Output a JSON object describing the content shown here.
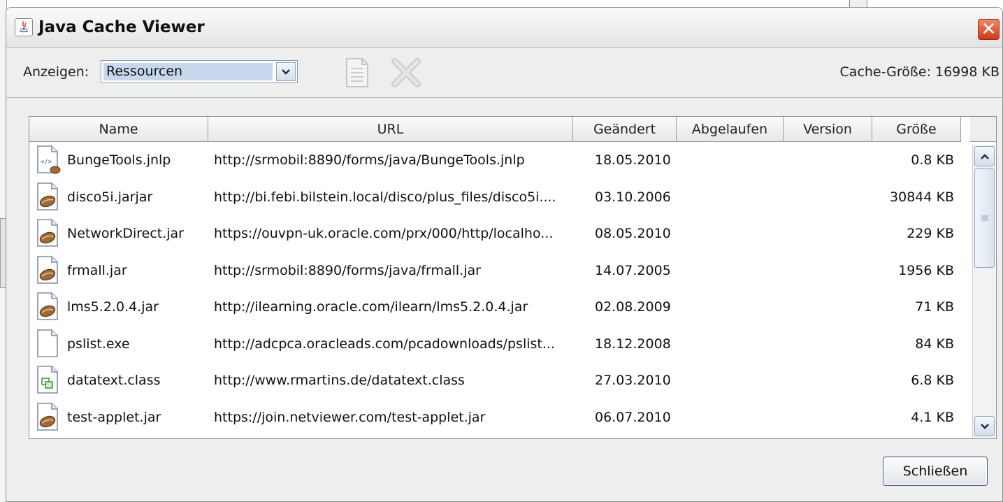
{
  "window": {
    "title": "Java Cache Viewer",
    "close_glyph": "✕"
  },
  "toolbar": {
    "show_label": "Anzeigen:",
    "show_value": "Ressourcen",
    "cache_size": "Cache-Größe:  16998 KB"
  },
  "table": {
    "headers": {
      "name": "Name",
      "url": "URL",
      "modified": "Geändert",
      "expired": "Abgelaufen",
      "version": "Version",
      "size": "Größe"
    },
    "rows": [
      {
        "icon": "jnlp-file-icon",
        "name": "BungeTools.jnlp",
        "url": "http://srmobil:8890/forms/java/BungeTools.jnlp",
        "modified": "18.05.2010",
        "expired": "",
        "version": "",
        "size": "0.8 KB"
      },
      {
        "icon": "jar-file-icon",
        "name": "disco5i.jarjar",
        "url": "http://bi.febi.bilstein.local/disco/plus_files/disco5i....",
        "modified": "03.10.2006",
        "expired": "",
        "version": "",
        "size": "30844 KB"
      },
      {
        "icon": "jar-file-icon",
        "name": "NetworkDirect.jar",
        "url": "https://ouvpn-uk.oracle.com/prx/000/http/localho...",
        "modified": "08.05.2010",
        "expired": "",
        "version": "",
        "size": "229 KB"
      },
      {
        "icon": "jar-file-icon",
        "name": "frmall.jar",
        "url": "http://srmobil:8890/forms/java/frmall.jar",
        "modified": "14.07.2005",
        "expired": "",
        "version": "",
        "size": "1956 KB"
      },
      {
        "icon": "jar-file-icon",
        "name": "lms5.2.0.4.jar",
        "url": "http://ilearning.oracle.com/ilearn/lms5.2.0.4.jar",
        "modified": "02.08.2009",
        "expired": "",
        "version": "",
        "size": "71 KB"
      },
      {
        "icon": "blank-file-icon",
        "name": "pslist.exe",
        "url": "http://adcpca.oracleads.com/pcadownloads/pslist...",
        "modified": "18.12.2008",
        "expired": "",
        "version": "",
        "size": "84 KB"
      },
      {
        "icon": "class-file-icon",
        "name": "datatext.class",
        "url": "http://www.rmartins.de/datatext.class",
        "modified": "27.03.2010",
        "expired": "",
        "version": "",
        "size": "6.8 KB"
      },
      {
        "icon": "jar-file-icon",
        "name": "test-applet.jar",
        "url": "https://join.netviewer.com/test-applet.jar",
        "modified": "06.07.2010",
        "expired": "",
        "version": "",
        "size": "4.1 KB"
      }
    ]
  },
  "footer": {
    "close_label": "Schließen"
  },
  "colors": {
    "selection": "#c8d8ec",
    "close_red": "#d4391a",
    "border_blue": "#7f9db9"
  }
}
